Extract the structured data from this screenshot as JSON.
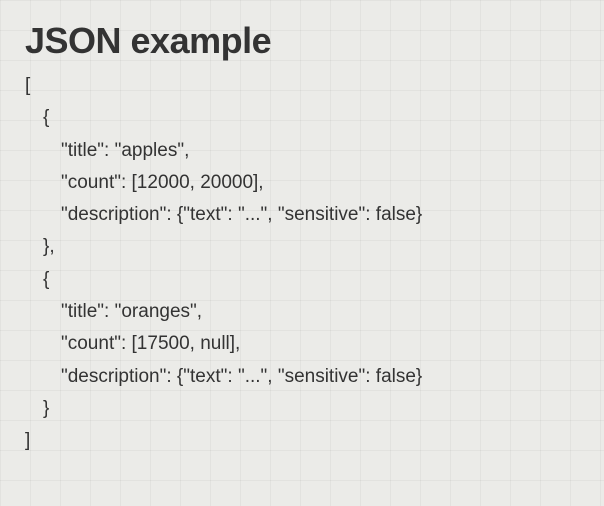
{
  "heading": "JSON example",
  "code": {
    "line1": "[",
    "line2": "{",
    "line3": "\"title\": \"apples\",",
    "line4": "\"count\": [12000, 20000],",
    "line5": "\"description\": {\"text\": \"...\", \"sensitive\": false}",
    "line6": "},",
    "line7": "{",
    "line8": "\"title\": \"oranges\",",
    "line9": "\"count\": [17500, null],",
    "line10": "\"description\": {\"text\": \"...\", \"sensitive\": false}",
    "line11": "}",
    "line12": "]"
  }
}
